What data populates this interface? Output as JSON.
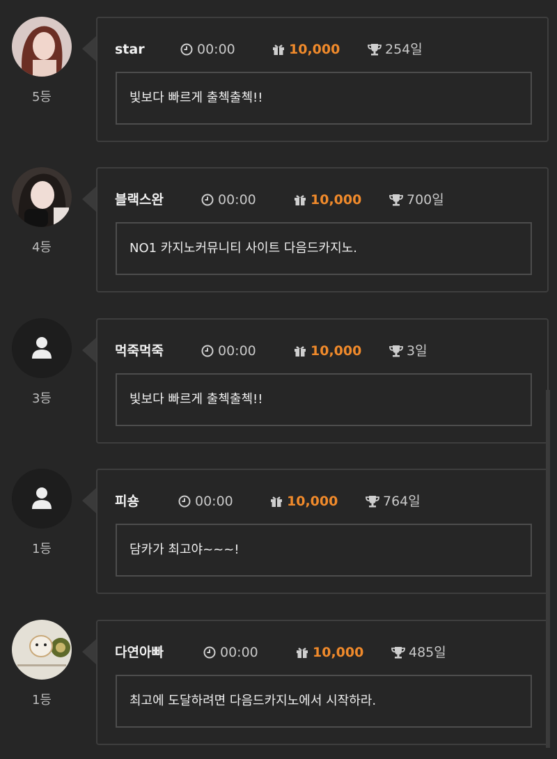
{
  "colors": {
    "background": "#262626",
    "accent": "#f08a2b",
    "border": "#3e3e3e"
  },
  "icons": {
    "clock": "clock-icon",
    "gift": "gift-icon",
    "trophy": "trophy-icon",
    "user": "user-icon"
  },
  "entries": [
    {
      "name": "star",
      "time": "00:00",
      "points": "10,000",
      "days": "254일",
      "rank": "5등",
      "message": "빛보다 빠르게 출첵출첵!!",
      "avatar": "photo"
    },
    {
      "name": "블랙스완",
      "time": "00:00",
      "points": "10,000",
      "days": "700일",
      "rank": "4등",
      "message": "NO1 카지노커뮤니티 사이트 다음드카지노.",
      "avatar": "photo"
    },
    {
      "name": "먹죽먹죽",
      "time": "00:00",
      "points": "10,000",
      "days": "3일",
      "rank": "3등",
      "message": "빛보다 빠르게 출첵출첵!!",
      "avatar": "default"
    },
    {
      "name": "피숑",
      "time": "00:00",
      "points": "10,000",
      "days": "764일",
      "rank": "1등",
      "message": "담카가 최고야~~~!",
      "avatar": "default"
    },
    {
      "name": "다연아빠",
      "time": "00:00",
      "points": "10,000",
      "days": "485일",
      "rank": "1등",
      "message": "최고에 도달하려면 다음드카지노에서 시작하라.",
      "avatar": "photo"
    }
  ]
}
